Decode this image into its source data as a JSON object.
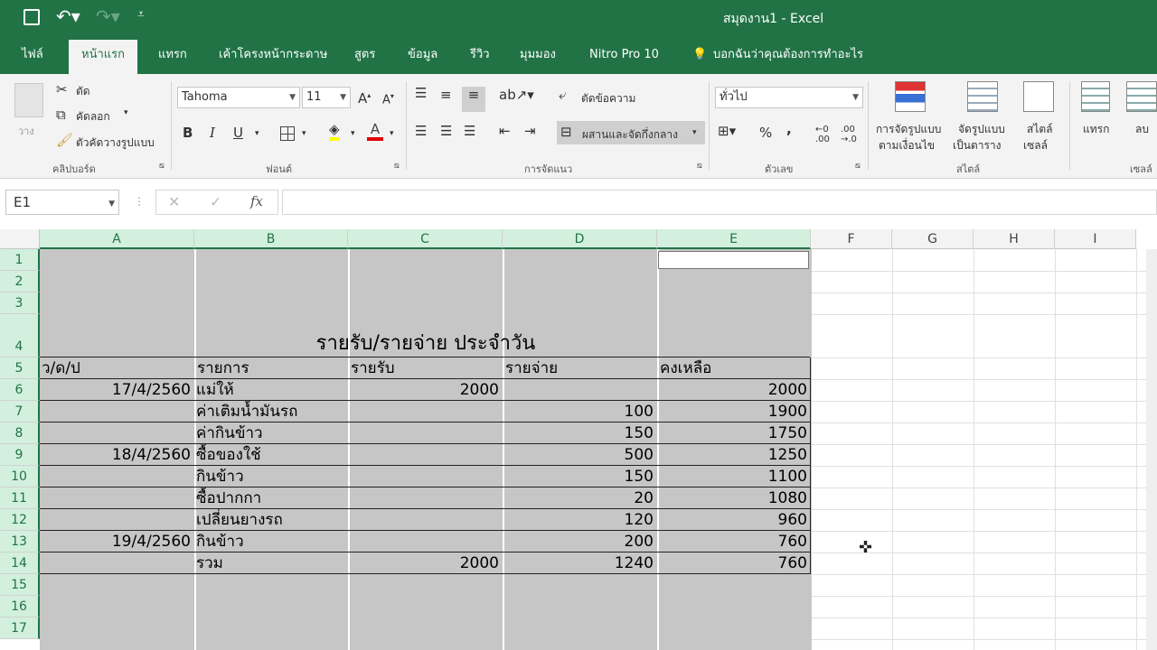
{
  "window": {
    "title": "สมุดงาน1  -  Excel"
  },
  "tabs": [
    "ไฟล์",
    "หน้าแรก",
    "แทรก",
    "เค้าโครงหน้ากระดาษ",
    "สูตร",
    "ข้อมูล",
    "รีวิว",
    "มุมมอง",
    "Nitro Pro 10"
  ],
  "tell_me": "บอกฉันว่าคุณต้องการทำอะไร",
  "clipboard": {
    "paste": "วาง",
    "cut": "ตัด",
    "copy": "คัดลอก",
    "format_painter": "ตัวคัดวางรูปแบบ",
    "label": "คลิปบอร์ด"
  },
  "font": {
    "name": "Tahoma",
    "size": "11",
    "bold": "B",
    "italic": "I",
    "underline": "U",
    "label": "ฟอนต์"
  },
  "alignment": {
    "wrap": "ตัดข้อความ",
    "merge": "ผสานและจัดกึ่งกลาง",
    "label": "การจัดแนว"
  },
  "number": {
    "format": "ทั่วไป",
    "percent": "%",
    "comma": ",",
    "label": "ตัวเลข"
  },
  "styles": {
    "conditional_1": "การจัดรูปแบบ",
    "conditional_2": "ตามเงื่อนไข",
    "table_1": "จัดรูปแบบ",
    "table_2": "เป็นตาราง",
    "cell_1": "สไตล์",
    "cell_2": "เซลล์",
    "label": "สไตล์"
  },
  "cells": {
    "insert": "แทรก",
    "delete": "ลบ",
    "label": "เซลล์"
  },
  "formula_bar": {
    "name_box": "E1",
    "fx": "fx",
    "value": ""
  },
  "columns": [
    "A",
    "B",
    "C",
    "D",
    "E",
    "F",
    "G",
    "H",
    "I"
  ],
  "rows": [
    "1",
    "2",
    "3",
    "4",
    "5",
    "6",
    "7",
    "8",
    "9",
    "10",
    "11",
    "12",
    "13",
    "14",
    "15",
    "16",
    "17"
  ],
  "sheet": {
    "title": "รายรับ/รายจ่าย ประจำวัน",
    "headers": [
      "ว/ด/ป",
      "รายการ",
      "รายรับ",
      "รายจ่าย",
      "คงเหลือ"
    ],
    "data": [
      [
        "17/4/2560",
        "แม่ให้",
        "2000",
        "",
        "2000"
      ],
      [
        "",
        "ค่าเติมน้ำมันรถ",
        "",
        "100",
        "1900"
      ],
      [
        "",
        "ค่ากินข้าว",
        "",
        "150",
        "1750"
      ],
      [
        "18/4/2560",
        "ซื้อของใช้",
        "",
        "500",
        "1250"
      ],
      [
        "",
        "กินข้าว",
        "",
        "150",
        "1100"
      ],
      [
        "",
        "ซื้อปากกา",
        "",
        "20",
        "1080"
      ],
      [
        "",
        "เปลี่ยนยางรถ",
        "",
        "120",
        "960"
      ],
      [
        "19/4/2560",
        "กินข้าว",
        "",
        "200",
        "760"
      ],
      [
        "",
        "รวม",
        "2000",
        "1240",
        "760"
      ]
    ]
  }
}
